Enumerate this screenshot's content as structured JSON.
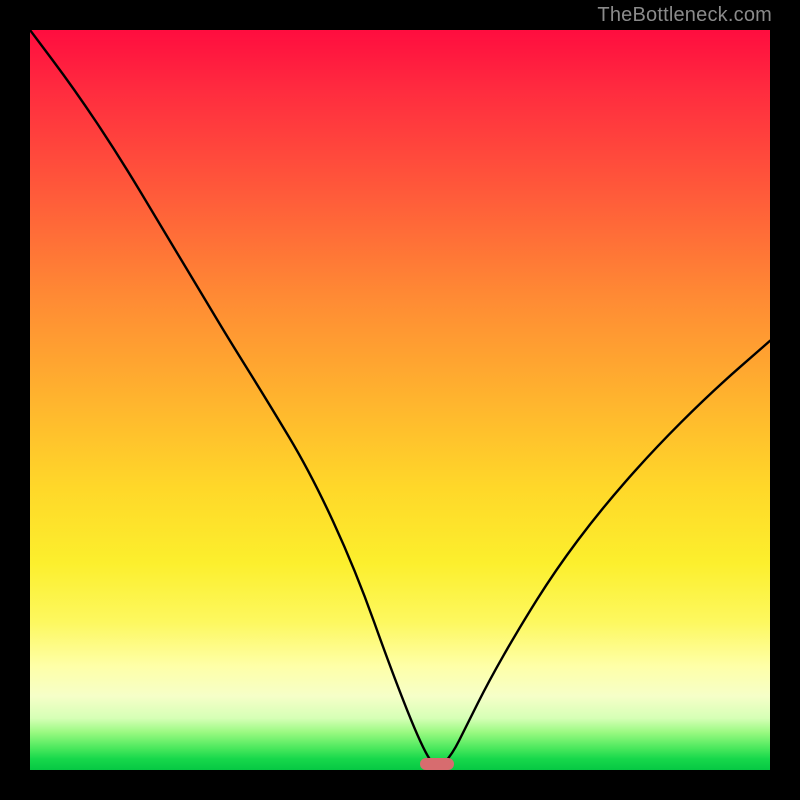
{
  "watermark": "TheBottleneck.com",
  "colors": {
    "frame": "#000000",
    "curve": "#000000",
    "marker": "#d76c6f",
    "gradient_top": "#ff0d3f",
    "gradient_bottom": "#06c843"
  },
  "marker": {
    "x_percent": 55,
    "y_percent": 99.2
  },
  "chart_data": {
    "type": "line",
    "title": "",
    "xlabel": "",
    "ylabel": "",
    "xlim": [
      0,
      100
    ],
    "ylim": [
      0,
      100
    ],
    "annotation": "TheBottleneck.com",
    "series": [
      {
        "name": "bottleneck-curve",
        "x": [
          0,
          6,
          12,
          18,
          24,
          27,
          32,
          38,
          44,
          49,
          53,
          55,
          57,
          59,
          62,
          66,
          71,
          77,
          84,
          92,
          100
        ],
        "values": [
          100,
          92,
          83,
          73,
          63,
          58,
          50,
          40,
          27,
          13,
          3,
          0,
          2,
          6,
          12,
          19,
          27,
          35,
          43,
          51,
          58
        ]
      }
    ],
    "marker_point": {
      "x": 55,
      "y": 0
    }
  }
}
